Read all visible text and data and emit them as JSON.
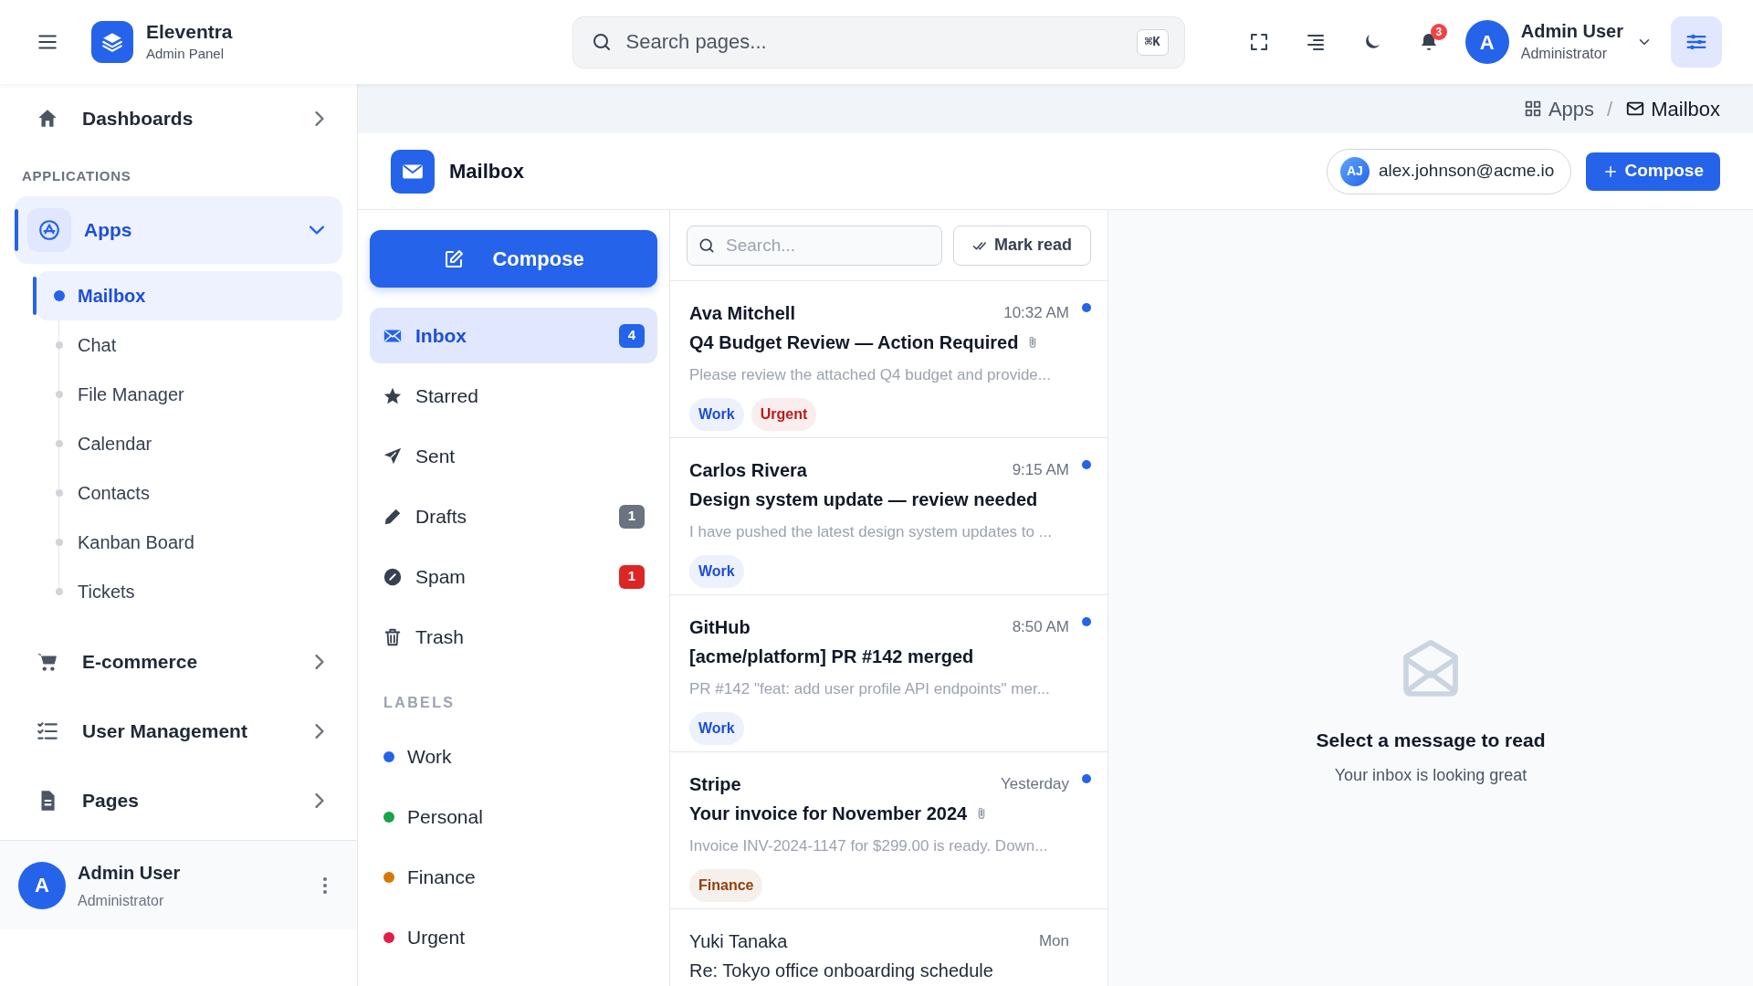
{
  "brand": {
    "name": "Eleventra",
    "subtitle": "Admin Panel"
  },
  "search": {
    "placeholder": "Search pages...",
    "shortcut": "⌘K"
  },
  "notifications": {
    "count": "3"
  },
  "user": {
    "initial": "A",
    "name": "Admin User",
    "role": "Administrator"
  },
  "sidebar": {
    "items": [
      {
        "label": "Dashboards",
        "expanded": false,
        "selected": false
      },
      {
        "kind": "heading",
        "label": "APPLICATIONS"
      },
      {
        "label": "Apps",
        "expanded": true,
        "selected": true,
        "children": [
          {
            "label": "Mailbox",
            "selected": true
          },
          {
            "label": "Chat",
            "selected": false
          },
          {
            "label": "File Manager",
            "selected": false
          },
          {
            "label": "Calendar",
            "selected": false
          },
          {
            "label": "Contacts",
            "selected": false
          },
          {
            "label": "Kanban Board",
            "selected": false
          },
          {
            "label": "Tickets",
            "selected": false
          }
        ]
      },
      {
        "label": "E-commerce",
        "expanded": false,
        "selected": false
      },
      {
        "label": "User Management",
        "expanded": false,
        "selected": false
      },
      {
        "label": "Pages",
        "expanded": false,
        "selected": false
      }
    ],
    "footer": {
      "initial": "A",
      "name": "Admin User",
      "role": "Administrator"
    }
  },
  "breadcrumb": [
    "Apps",
    "Mailbox"
  ],
  "breadcrumb_separator": "/",
  "page": {
    "title": "Mailbox",
    "account": {
      "initials": "AJ",
      "email": "alex.johnson@acme.io"
    },
    "compose": "Compose"
  },
  "folders": {
    "compose": "Compose",
    "items": [
      {
        "label": "Inbox",
        "count": "4",
        "selected": true,
        "color": "#2563eb"
      },
      {
        "label": "Starred",
        "selected": false
      },
      {
        "label": "Sent",
        "selected": false
      },
      {
        "label": "Drafts",
        "count": "1",
        "selected": false,
        "color": "#6b7280"
      },
      {
        "label": "Spam",
        "count": "1",
        "selected": false,
        "color": "#dc2626"
      },
      {
        "label": "Trash",
        "selected": false
      }
    ],
    "labels_heading": "LABELS",
    "labels": [
      {
        "label": "Work",
        "color": "#2563eb"
      },
      {
        "label": "Personal",
        "color": "#16a34a"
      },
      {
        "label": "Finance",
        "color": "#d97706"
      },
      {
        "label": "Urgent",
        "color": "#e11d48"
      }
    ]
  },
  "list": {
    "search_placeholder": "Search...",
    "mark_read": "Mark read",
    "messages": [
      {
        "sender": "Ava Mitchell",
        "time": "10:32 AM",
        "subject": "Q4 Budget Review — Action Required",
        "attachment": true,
        "preview": "Please review the attached Q4 budget and provide...",
        "unread": true,
        "tags": [
          {
            "label": "Work",
            "color": "#1d4ed8"
          },
          {
            "label": "Urgent",
            "color": "#b91c1c"
          }
        ]
      },
      {
        "sender": "Carlos Rivera",
        "time": "9:15 AM",
        "subject": "Design system update — review needed",
        "attachment": false,
        "preview": "I have pushed the latest design system updates to ...",
        "unread": true,
        "tags": [
          {
            "label": "Work",
            "color": "#1d4ed8"
          }
        ]
      },
      {
        "sender": "GitHub",
        "time": "8:50 AM",
        "subject": "[acme/platform] PR #142 merged",
        "attachment": false,
        "preview": "PR #142 \"feat: add user profile API endpoints\" mer...",
        "unread": true,
        "tags": [
          {
            "label": "Work",
            "color": "#1d4ed8"
          }
        ]
      },
      {
        "sender": "Stripe",
        "time": "Yesterday",
        "subject": "Your invoice for November 2024",
        "attachment": true,
        "preview": "Invoice INV-2024-1147 for $299.00 is ready. Down...",
        "unread": true,
        "tags": [
          {
            "label": "Finance",
            "color": "#92400e"
          }
        ]
      },
      {
        "sender": "Yuki Tanaka",
        "time": "Mon",
        "subject": "Re: Tokyo office onboarding schedule",
        "attachment": false,
        "unread": false
      }
    ]
  },
  "reader": {
    "title": "Select a message to read",
    "subtitle": "Your inbox is looking great"
  }
}
